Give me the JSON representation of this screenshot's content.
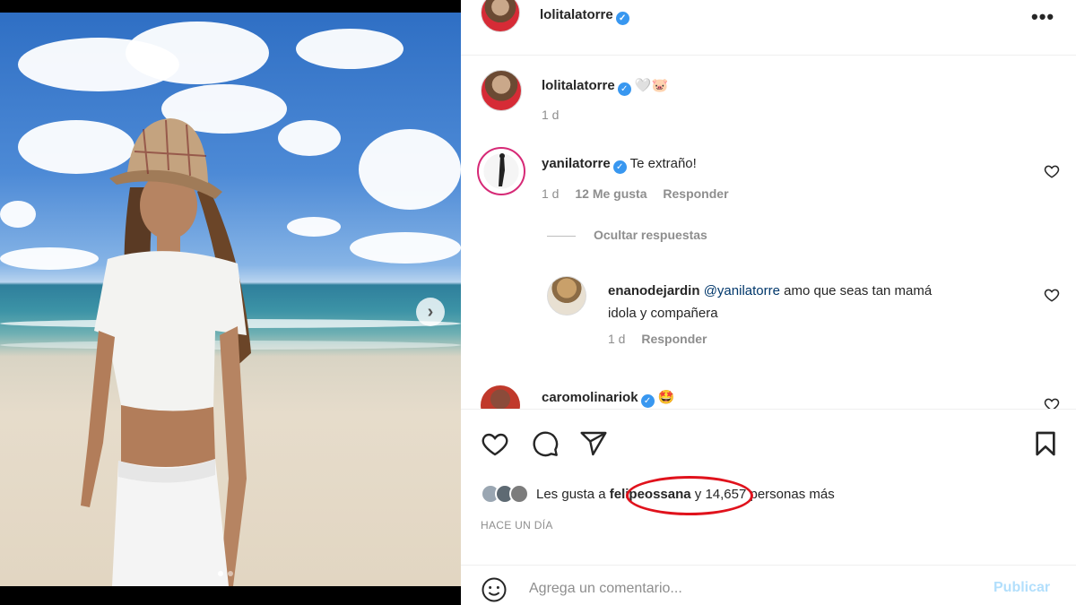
{
  "post": {
    "author": "lolitalatorre",
    "caption_emojis": "🤍🐷",
    "caption_age": "1 d"
  },
  "comments": [
    {
      "user": "yanilatorre",
      "text": "Te extraño!",
      "age": "1 d",
      "likes": "12 Me gusta",
      "reply_label": "Responder"
    }
  ],
  "hide_replies_label": "Ocultar respuestas",
  "reply": {
    "user": "enanodejardin",
    "mention": "@yanilatorre",
    "text_line1": "amo que seas tan mamá",
    "text_line2": "idola y compañera",
    "age": "1 d",
    "reply_label": "Responder"
  },
  "partial_comment": {
    "user": "caromolinariok",
    "emoji": "🤩"
  },
  "likes": {
    "prefix": "Les gusta a",
    "liker": "felipeossana",
    "suffix": "y 14,657 personas más"
  },
  "timestamp": "HACE UN DÍA",
  "comment_box": {
    "placeholder": "Agrega un comentario...",
    "publish_label": "Publicar"
  },
  "colors": {
    "verified": "#3897f0",
    "annotation": "#e0121c",
    "publish_disabled": "#b2dffc"
  }
}
